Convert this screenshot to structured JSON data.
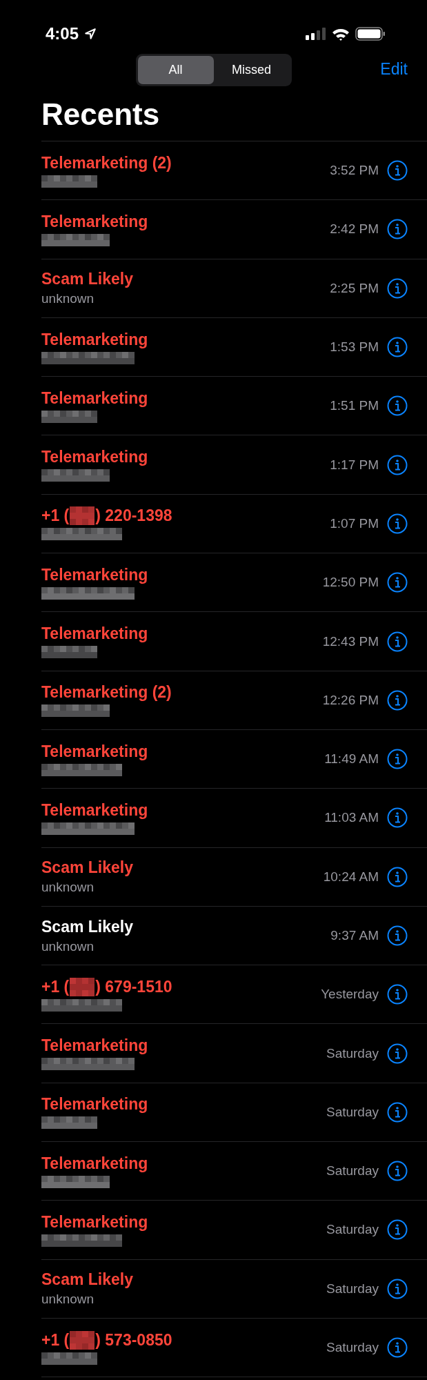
{
  "status_bar": {
    "time": "4:05"
  },
  "segments": [
    {
      "label": "All",
      "selected": true
    },
    {
      "label": "Missed",
      "selected": false
    }
  ],
  "edit_label": "Edit",
  "title": "Recents",
  "calls": [
    {
      "kind": "contact",
      "name": "Telemarketing (2)",
      "missed": true,
      "detail_redacted": true,
      "time": "3:52 PM"
    },
    {
      "kind": "contact",
      "name": "Telemarketing",
      "missed": true,
      "detail_redacted": true,
      "time": "2:42 PM"
    },
    {
      "kind": "contact",
      "name": "Scam Likely",
      "missed": true,
      "detail": "unknown",
      "time": "2:25 PM"
    },
    {
      "kind": "contact",
      "name": "Telemarketing",
      "missed": true,
      "detail_redacted": true,
      "time": "1:53 PM"
    },
    {
      "kind": "contact",
      "name": "Telemarketing",
      "missed": true,
      "detail_redacted": true,
      "time": "1:51 PM"
    },
    {
      "kind": "contact",
      "name": "Telemarketing",
      "missed": true,
      "detail_redacted": true,
      "time": "1:17 PM"
    },
    {
      "kind": "number",
      "name_start": "+1 (",
      "name_end": ") 220-1398",
      "missed": true,
      "detail_redacted": true,
      "time": "1:07 PM"
    },
    {
      "kind": "contact",
      "name": "Telemarketing",
      "missed": true,
      "detail_redacted": true,
      "time": "12:50 PM"
    },
    {
      "kind": "contact",
      "name": "Telemarketing",
      "missed": true,
      "detail_redacted": true,
      "time": "12:43 PM"
    },
    {
      "kind": "contact",
      "name": "Telemarketing (2)",
      "missed": true,
      "detail_redacted": true,
      "time": "12:26 PM"
    },
    {
      "kind": "contact",
      "name": "Telemarketing",
      "missed": true,
      "detail_redacted": true,
      "time": "11:49 AM"
    },
    {
      "kind": "contact",
      "name": "Telemarketing",
      "missed": true,
      "detail_redacted": true,
      "time": "11:03 AM"
    },
    {
      "kind": "contact",
      "name": "Scam Likely",
      "missed": true,
      "detail": "unknown",
      "time": "10:24 AM"
    },
    {
      "kind": "contact",
      "name": "Scam Likely",
      "missed": false,
      "detail": "unknown",
      "time": "9:37 AM"
    },
    {
      "kind": "number",
      "name_start": "+1 (",
      "name_end": ") 679-1510",
      "missed": true,
      "detail_redacted": true,
      "time": "Yesterday"
    },
    {
      "kind": "contact",
      "name": "Telemarketing",
      "missed": true,
      "detail_redacted": true,
      "time": "Saturday"
    },
    {
      "kind": "contact",
      "name": "Telemarketing",
      "missed": true,
      "detail_redacted": true,
      "time": "Saturday"
    },
    {
      "kind": "contact",
      "name": "Telemarketing",
      "missed": true,
      "detail_redacted": true,
      "time": "Saturday"
    },
    {
      "kind": "contact",
      "name": "Telemarketing",
      "missed": true,
      "detail_redacted": true,
      "time": "Saturday"
    },
    {
      "kind": "contact",
      "name": "Scam Likely",
      "missed": true,
      "detail": "unknown",
      "time": "Saturday"
    },
    {
      "kind": "number",
      "name_start": "+1 (",
      "name_end": ") 573-0850",
      "missed": true,
      "detail_redacted": true,
      "time": "Saturday"
    }
  ]
}
